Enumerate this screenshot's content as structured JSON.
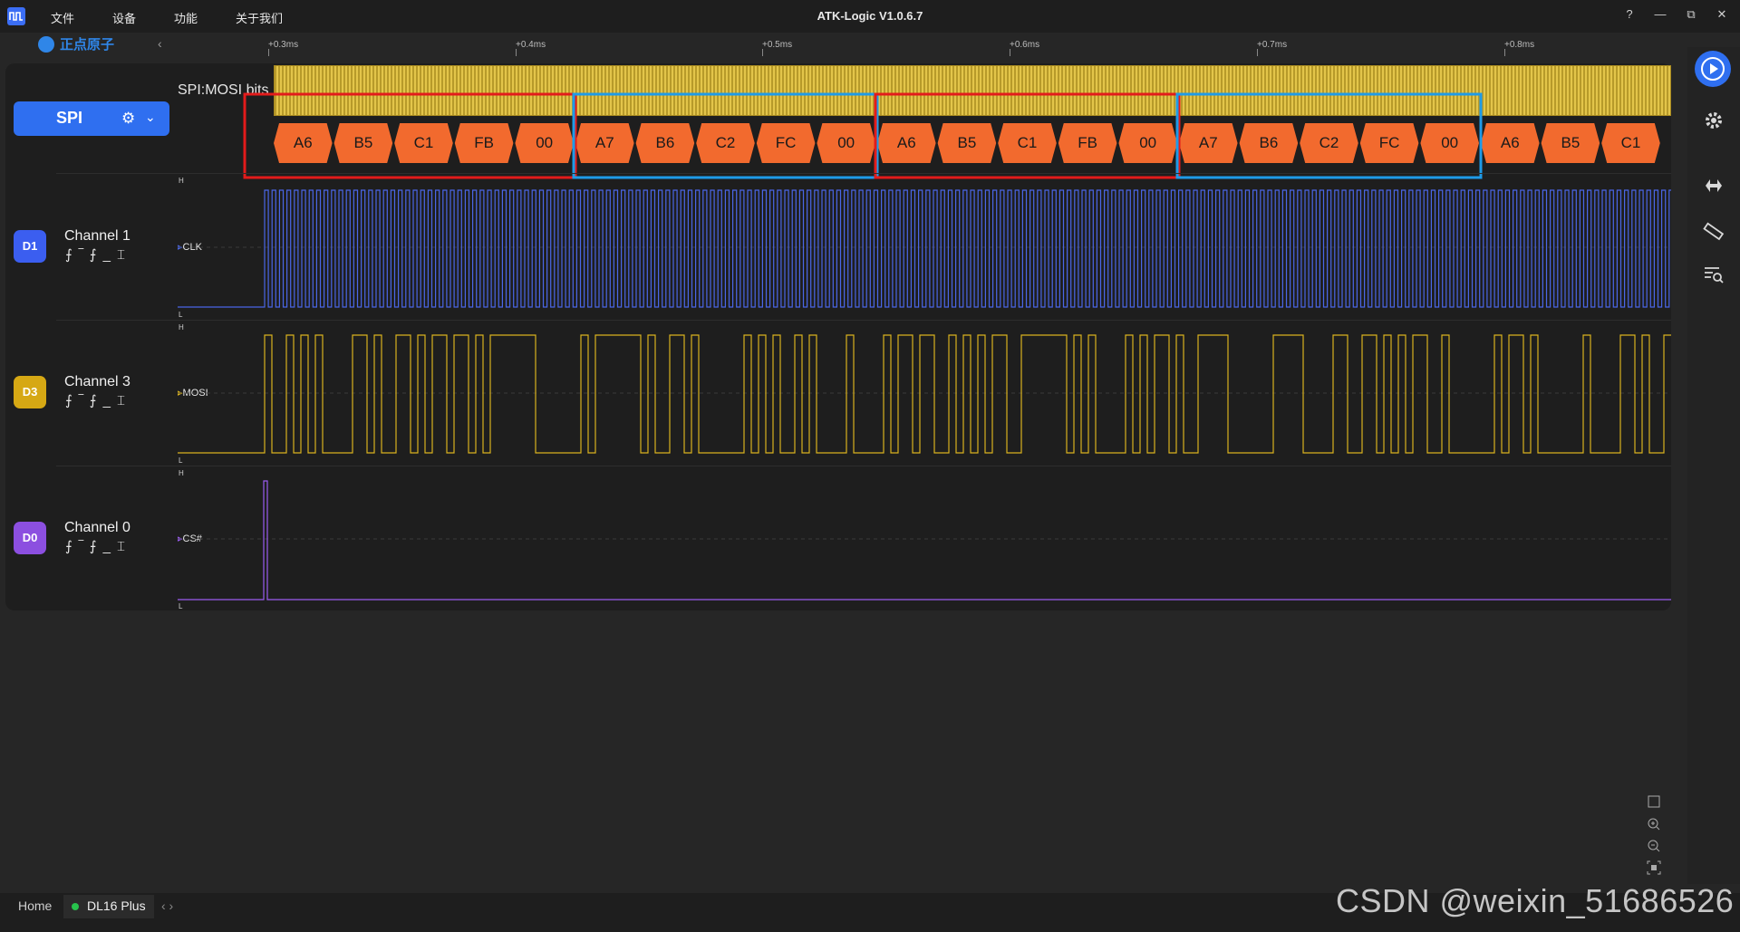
{
  "titlebar": {
    "menu": [
      "文件",
      "设备",
      "功能",
      "关于我们"
    ],
    "title": "ATK-Logic  V1.0.6.7",
    "controls": [
      "?",
      "—",
      "⧉",
      "✕"
    ]
  },
  "toolbar": {
    "brand": "正点原子",
    "collapse": "‹"
  },
  "ruler": {
    "ticks": [
      "+0.3ms",
      "+0.4ms",
      "+0.5ms",
      "+0.6ms",
      "+0.7ms",
      "+0.8ms"
    ]
  },
  "decoder": {
    "button_label": "SPI",
    "gear": "⚙",
    "chevron": "⌄",
    "track_label": "SPI:MOSI bits",
    "bytes": [
      "A6",
      "B5",
      "C1",
      "FB",
      "00",
      "A7",
      "B6",
      "C2",
      "FC",
      "00",
      "A6",
      "B5",
      "C1",
      "FB",
      "00",
      "A7",
      "B6",
      "C2",
      "FC",
      "00",
      "A6",
      "B5",
      "C1"
    ],
    "highlight_colors": [
      "#e31b1b",
      "#1e9be8"
    ]
  },
  "channels": [
    {
      "badge": "D1",
      "name": "Channel 1",
      "signal": "CLK",
      "color": "#3b5ef0",
      "wave": "#4a66e6",
      "trig": "⨍‾⨍_⌶"
    },
    {
      "badge": "D3",
      "name": "Channel 3",
      "signal": "MOSI",
      "color": "#d6a814",
      "wave": "#d9b21e",
      "trig": "⨍‾⨍_⌶"
    },
    {
      "badge": "D0",
      "name": "Channel 0",
      "signal": "CS#",
      "color": "#8c4fe0",
      "wave": "#9a5cf0",
      "trig": "⨍‾⨍_⌶"
    }
  ],
  "levels": {
    "high": "H",
    "low": "L"
  },
  "tabs": {
    "home": "Home",
    "device": "DL16 Plus",
    "arrows": "‹ ›"
  },
  "watermark": "CSDN @weixin_51686526",
  "accent": "#2f6ff0"
}
